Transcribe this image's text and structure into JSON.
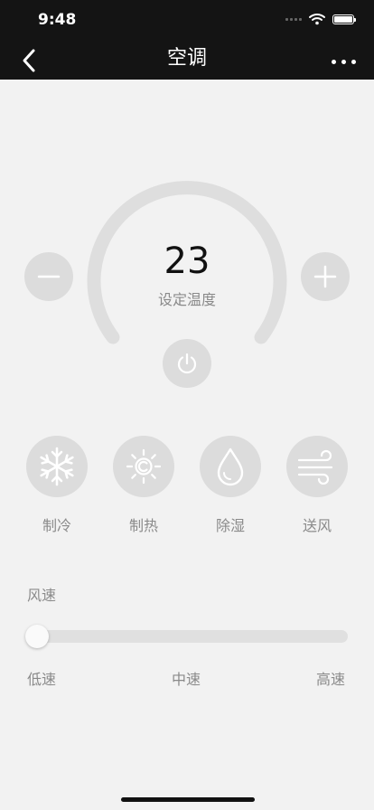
{
  "status_bar": {
    "time": "9:48"
  },
  "header": {
    "title": "空调"
  },
  "temperature": {
    "value": "23",
    "label": "设定温度"
  },
  "modes": [
    {
      "label": "制冷",
      "icon": "snowflake-icon"
    },
    {
      "label": "制热",
      "icon": "sun-icon"
    },
    {
      "label": "除湿",
      "icon": "droplet-icon"
    },
    {
      "label": "送风",
      "icon": "wind-icon"
    }
  ],
  "wind_speed": {
    "title": "风速",
    "levels": [
      "低速",
      "中速",
      "高速"
    ],
    "value": 0
  },
  "colors": {
    "header_bg": "#141414",
    "page_bg": "#f2f2f2",
    "control_bg": "#dcdcdc",
    "icon": "#ffffff",
    "label": "#8a8a8a"
  }
}
